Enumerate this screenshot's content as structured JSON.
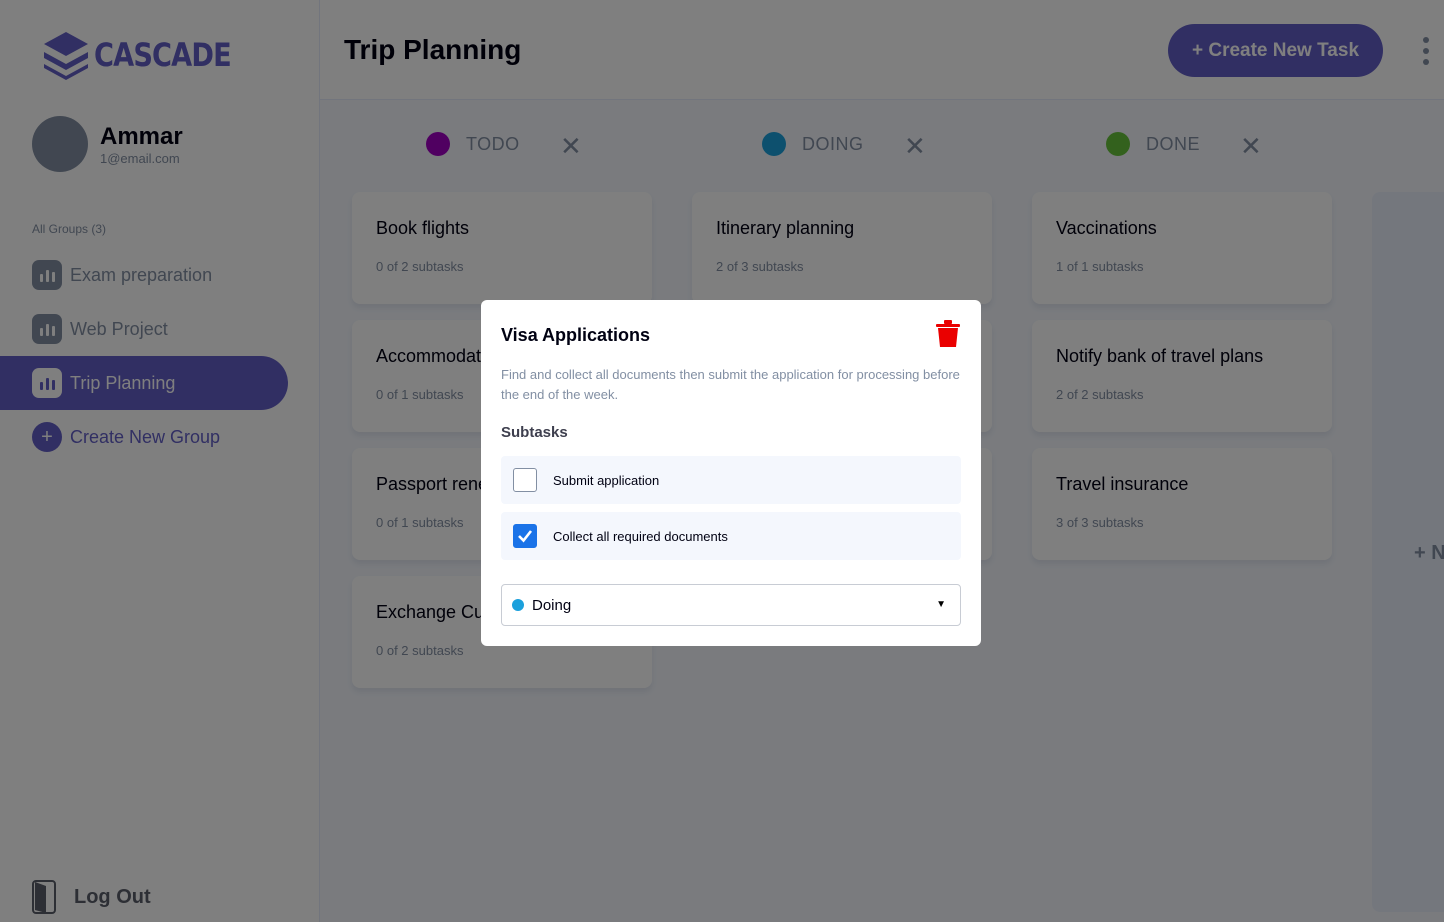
{
  "app": {
    "name": "CASCADE",
    "brand_color": "#635fc7"
  },
  "user": {
    "name": "Ammar",
    "email": "1@email.com"
  },
  "sidebar": {
    "groups_header": "All Groups (3)",
    "items": [
      {
        "label": "Exam preparation",
        "icon": "chart-bars-icon",
        "active": false
      },
      {
        "label": "Web Project",
        "icon": "chart-bars-icon",
        "active": false
      },
      {
        "label": "Trip Planning",
        "icon": "chart-bars-icon",
        "active": true
      }
    ],
    "create_label": "Create New Group",
    "create_symbol": "+",
    "logout_label": "Log Out"
  },
  "header": {
    "title": "Trip Planning",
    "create_task_label": "+ Create New Task"
  },
  "columns": [
    {
      "name": "TODO",
      "color": "#a100c2",
      "close_symbol": "✕",
      "cards": [
        {
          "title": "Book flights",
          "subtasks": "0 of 2 subtasks"
        },
        {
          "title": "Accommodation",
          "subtasks": "0 of 1 subtasks"
        },
        {
          "title": "Passport renewal",
          "subtasks": "0 of 1 subtasks"
        },
        {
          "title": "Exchange Currency",
          "subtasks": "0 of 2 subtasks"
        }
      ]
    },
    {
      "name": "DOING",
      "color": "#1ba0dc",
      "close_symbol": "✕",
      "cards": [
        {
          "title": "Itinerary planning",
          "subtasks": "2 of 3 subtasks"
        }
      ]
    },
    {
      "name": "DONE",
      "color": "#67c23a",
      "close_symbol": "✕",
      "cards": [
        {
          "title": "Vaccinations",
          "subtasks": "1 of 1 subtasks"
        },
        {
          "title": "Notify bank of travel plans",
          "subtasks": "2 of 2 subtasks"
        },
        {
          "title": "Travel insurance",
          "subtasks": "3 of 3 subtasks"
        }
      ]
    }
  ],
  "new_column_label": "+ N",
  "modal": {
    "title": "Visa Applications",
    "description": "Find and collect all documents then submit the application for processing before the end of the week.",
    "subtasks_label": "Subtasks",
    "subtasks": [
      {
        "label": "Submit application",
        "checked": false
      },
      {
        "label": "Collect all required documents",
        "checked": true
      }
    ],
    "status": {
      "label": "Doing",
      "color": "#1ba0dc"
    },
    "delete_icon": "trash-icon",
    "delete_color": "#ea0000"
  }
}
